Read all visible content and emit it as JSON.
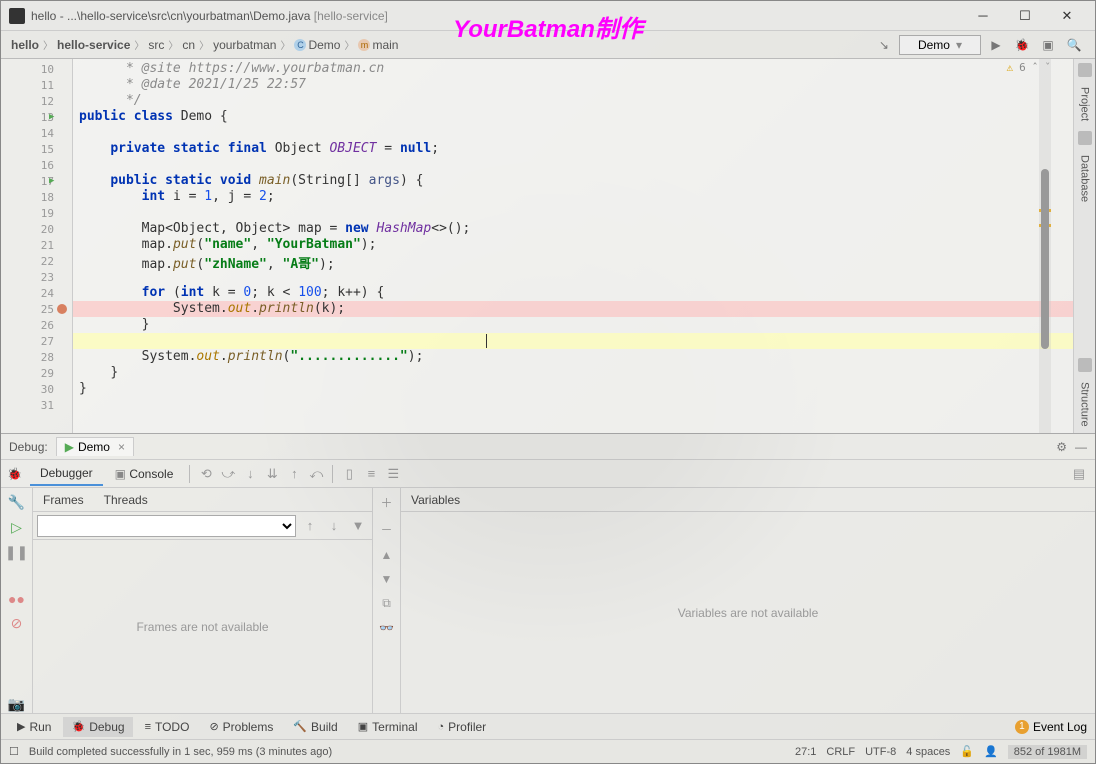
{
  "window": {
    "title": "hello - ...\\hello-service\\src\\cn\\yourbatman\\Demo.java",
    "module": "[hello-service]",
    "watermark": "YourBatman制作"
  },
  "breadcrumbs": [
    "hello",
    "hello-service",
    "src",
    "cn",
    "yourbatman",
    "Demo",
    "main"
  ],
  "runConfig": "Demo",
  "warnings": {
    "count": "6"
  },
  "rightTabs": [
    "Project",
    "Database",
    "Structure"
  ],
  "gutter": {
    "start": 10,
    "end": 31,
    "runMarks": [
      13,
      17
    ],
    "breakpoints": [
      25
    ]
  },
  "code": {
    "l10": " * @site https://www.yourbatman.cn",
    "l11": " * @date 2021/1/25 22:57",
    "l12": " */",
    "l13_kw1": "public",
    "l13_kw2": "class",
    "l13_name": "Demo",
    "l13_brace": " {",
    "l15_kw": "private static final ",
    "l15_type": "Object ",
    "l15_field": "OBJECT",
    "l15_rest": " = ",
    "l15_kw2": "null",
    "l15_semi": ";",
    "l17_kw": "public static void ",
    "l17_fn": "main",
    "l17_p1": "(",
    "l17_type": "String[] ",
    "l17_arg": "args",
    "l17_p2": ") {",
    "l18_kw": "int ",
    "l18_v1": "i = ",
    "l18_n1": "1",
    "l18_c": ", ",
    "l18_v2": "j = ",
    "l18_n2": "2",
    "l18_s": ";",
    "l20_type": "Map",
    "l20_g": "<Object, Object> ",
    "l20_v": "map = ",
    "l20_kw": "new ",
    "l20_cls": "HashMap",
    "l20_e": "<>();",
    "l21_a": "map.",
    "l21_fn": "put",
    "l21_p": "(",
    "l21_s1": "\"name\"",
    "l21_c": ", ",
    "l21_s2": "\"YourBatman\"",
    "l21_e": ");",
    "l22_a": "map.",
    "l22_fn": "put",
    "l22_p": "(",
    "l22_s1": "\"zhName\"",
    "l22_c": ", ",
    "l22_s2": "\"A哥\"",
    "l22_e": ");",
    "l24_kw": "for ",
    "l24_p": "(",
    "l24_kw2": "int ",
    "l24_v": "k = ",
    "l24_n1": "0",
    "l24_c": "; k < ",
    "l24_n2": "100",
    "l24_c2": "; k++) {",
    "l25_a": "System.",
    "l25_f": "out",
    "l25_d": ".",
    "l25_fn": "println",
    "l25_p": "(k);",
    "l26": "}",
    "l28_a": "System.",
    "l28_f": "out",
    "l28_d": ".",
    "l28_fn": "println",
    "l28_p": "(",
    "l28_s": "\".............\"",
    "l28_e": ");",
    "l29": "}",
    "l30": "}"
  },
  "debug": {
    "label": "Debug:",
    "tabName": "Demo",
    "tabs": {
      "debugger": "Debugger",
      "console": "Console"
    },
    "frames": {
      "tab1": "Frames",
      "tab2": "Threads",
      "empty": "Frames are not available"
    },
    "vars": {
      "title": "Variables",
      "empty": "Variables are not available"
    }
  },
  "bottomTabs": {
    "run": "Run",
    "debug": "Debug",
    "todo": "TODO",
    "problems": "Problems",
    "build": "Build",
    "terminal": "Terminal",
    "profiler": "Profiler",
    "eventLog": "Event Log",
    "eventBadge": "1"
  },
  "status": {
    "msg": "Build completed successfully in 1 sec, 959 ms (3 minutes ago)",
    "pos": "27:1",
    "eol": "CRLF",
    "enc": "UTF-8",
    "indent": "4 spaces",
    "mem": "852 of 1981M"
  }
}
